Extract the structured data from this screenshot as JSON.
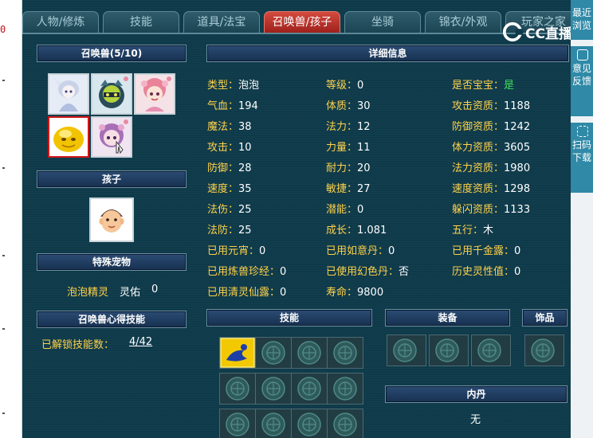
{
  "tabs": [
    "人物/修炼",
    "技能",
    "道具/法宝",
    "召唤兽/孩子",
    "坐骑",
    "锦衣/外观",
    "玩家之家"
  ],
  "active_tab": 3,
  "summon": {
    "header": "召唤兽(5/10)",
    "pets": [
      "ice-fairy-pet",
      "armored-beast-pet",
      "pink-flower-girl-pet",
      "yellow-bubble-pet",
      "purple-flower-pet"
    ],
    "selected_index": 3
  },
  "child": {
    "header": "孩子",
    "avatar": "child-boy"
  },
  "special": {
    "header": "特殊宠物",
    "name": "泡泡精灵",
    "label": "灵佑",
    "value": "0"
  },
  "mind_skill": {
    "header": "召唤兽心得技能",
    "label": "已解锁技能数：",
    "value": "4/42"
  },
  "detail": {
    "header": "详细信息",
    "col1": [
      {
        "k": "类型：",
        "v": "泡泡"
      },
      {
        "k": "气血：",
        "v": "194"
      },
      {
        "k": "魔法：",
        "v": "38"
      },
      {
        "k": "攻击：",
        "v": "10"
      },
      {
        "k": "防御：",
        "v": "28"
      },
      {
        "k": "速度：",
        "v": "35"
      },
      {
        "k": "法伤：",
        "v": "25"
      },
      {
        "k": "法防：",
        "v": "25"
      },
      {
        "k": "已用元宵：",
        "v": "0"
      },
      {
        "k": "已用炼兽珍经：",
        "v": "0"
      },
      {
        "k": "已用清灵仙露：",
        "v": "0"
      }
    ],
    "col2": [
      {
        "k": "等级：",
        "v": "0"
      },
      {
        "k": "体质：",
        "v": "30"
      },
      {
        "k": "法力：",
        "v": "12"
      },
      {
        "k": "力量：",
        "v": "11"
      },
      {
        "k": "耐力：",
        "v": "20"
      },
      {
        "k": "敏捷：",
        "v": "27"
      },
      {
        "k": "潜能：",
        "v": "0"
      },
      {
        "k": "成长：",
        "v": "1.081"
      },
      {
        "k": "已用如意丹：",
        "v": "0"
      },
      {
        "k": "已使用幻色丹：",
        "v": "否"
      },
      {
        "k": "寿命：",
        "v": "9800"
      }
    ],
    "col3": [
      {
        "k": "是否宝宝：",
        "v": "是"
      },
      {
        "k": "攻击资质：",
        "v": "1188"
      },
      {
        "k": "防御资质：",
        "v": "1242"
      },
      {
        "k": "体力资质：",
        "v": "3605"
      },
      {
        "k": "法力资质：",
        "v": "1980"
      },
      {
        "k": "速度资质：",
        "v": "1298"
      },
      {
        "k": "躲闪资质：",
        "v": "1133"
      },
      {
        "k": "五行：",
        "v": "木"
      },
      {
        "k": "已用千金露：",
        "v": "0"
      },
      {
        "k": "历史灵性值：",
        "v": "0"
      }
    ]
  },
  "skills_header": "技能",
  "skills": [
    "water-splash-skill-icon"
  ],
  "equip_header": "装备",
  "accessory_header": "饰品",
  "neidan": {
    "header": "内丹",
    "value": "无"
  },
  "overlay": {
    "brand": "CC直播",
    "side": [
      "最近浏览",
      "意见反馈",
      "扫码下载"
    ]
  },
  "colors": {
    "label": "#ffd24a",
    "value": "#ffffff",
    "yes": "#3ee05a",
    "active_tab": "#c0342c"
  }
}
